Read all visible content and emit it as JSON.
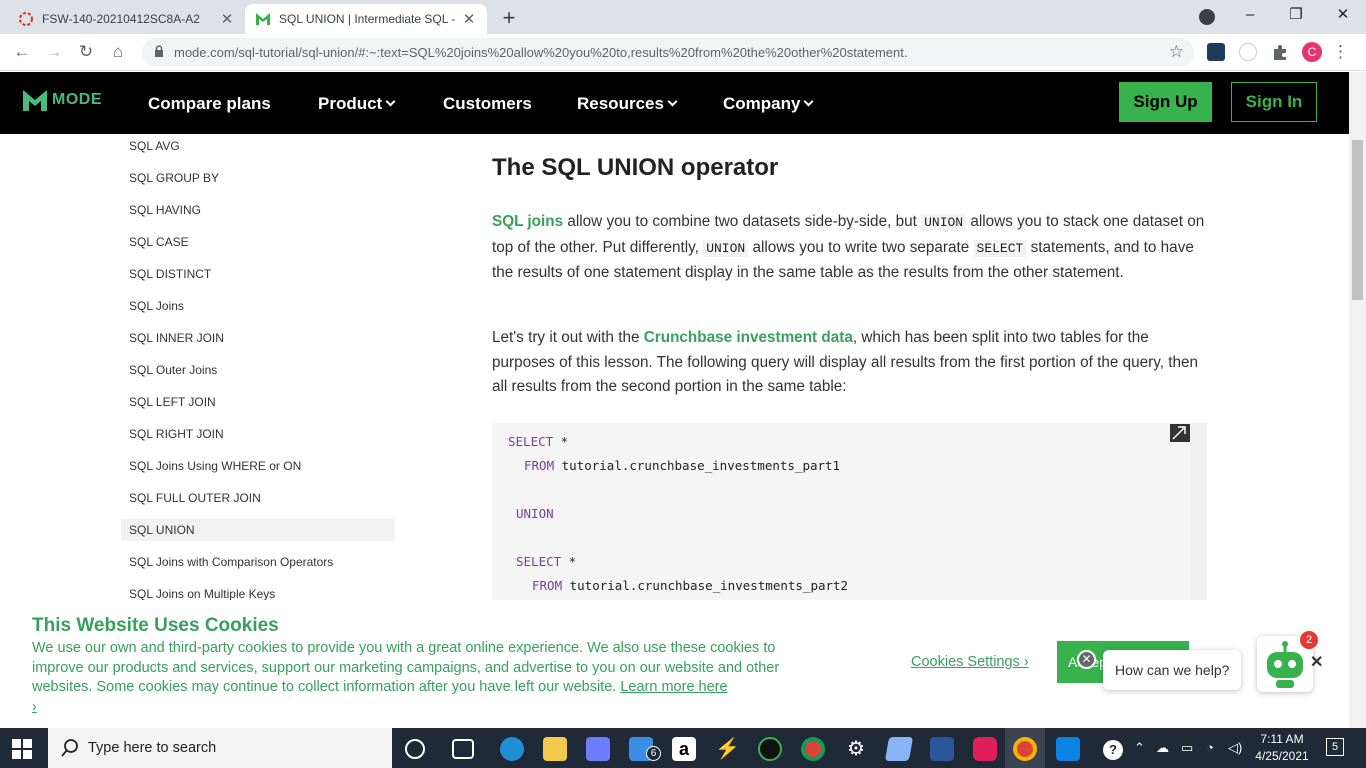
{
  "browser": {
    "tabs": [
      {
        "title": "FSW-140-20210412SC8A-A2",
        "active": false
      },
      {
        "title": "SQL UNION | Intermediate SQL -",
        "active": true
      }
    ],
    "new_tab": "+",
    "window_controls": {
      "minimize": "–",
      "maximize": "❐",
      "close": "✕"
    },
    "url": "mode.com/sql-tutorial/sql-union/#:~:text=SQL%20joins%20allow%20you%20to,results%20from%20the%20other%20statement.",
    "profile_initial": "C"
  },
  "site_nav": {
    "logo": "MODE",
    "links": [
      "Compare plans",
      "Product",
      "Customers",
      "Resources",
      "Company"
    ],
    "signup": "Sign Up",
    "signin": "Sign In"
  },
  "sidebar": {
    "items": [
      "SQL AVG",
      "SQL GROUP BY",
      "SQL HAVING",
      "SQL CASE",
      "SQL DISTINCT",
      "SQL Joins",
      "SQL INNER JOIN",
      "SQL Outer Joins",
      "SQL LEFT JOIN",
      "SQL RIGHT JOIN",
      "SQL Joins Using WHERE or ON",
      "SQL FULL OUTER JOIN",
      "SQL UNION",
      "SQL Joins with Comparison Operators",
      "SQL Joins on Multiple Keys"
    ],
    "selected": "SQL UNION"
  },
  "article": {
    "heading": "The SQL UNION operator",
    "p1": {
      "link": "SQL joins",
      "t1": " allow you to combine two datasets side-by-side, but ",
      "c1": "UNION",
      "t2": " allows you to stack one dataset on top of the other. Put differently, ",
      "c2": "UNION",
      "t3": " allows you to write two separate ",
      "c3": "SELECT",
      "t4": " statements, and to have the results of one statement display in the same table as the results from the other statement."
    },
    "p2": {
      "t1": "Let's try it out with the ",
      "link": "Crunchbase investment data",
      "t2": ", which has been split into two tables for the purposes of this lesson. The following query will display all results from the first portion of the query, then all results from the second portion in the same table:"
    },
    "code": {
      "l1_kw": "SELECT",
      "l1_rest": " *",
      "l2_kw": "FROM",
      "l2_rest": " tutorial.crunchbase_investments_part1",
      "l3_kw": "UNION",
      "l4_kw": "SELECT",
      "l4_rest": " *",
      "l5_kw": "FROM",
      "l5_rest": " tutorial.crunchbase_investments_part2"
    }
  },
  "cookie_banner": {
    "title": "This Website Uses Cookies",
    "text": "We use our own and third-party cookies to provide you with a great online experience. We also use these cookies to improve our products and services, support our marketing campaigns, and advertise to you on our website and other websites. Some cookies may continue to collect information after you have left our website.",
    "learn_more": "Learn more here",
    "learn_more_arrow": "›",
    "settings": "Cookies Settings ›",
    "accept": "Accept All Cookies"
  },
  "chat": {
    "prompt": "How can we help?",
    "badge": "2"
  },
  "taskbar": {
    "search_placeholder": "Type here to search",
    "mail_badge": "6",
    "time": "7:11 AM",
    "date": "4/25/2021",
    "notifications": "5"
  },
  "colors": {
    "brand_green": "#37b24d",
    "link_green": "#37a05a",
    "nav_bg": "#000000"
  }
}
